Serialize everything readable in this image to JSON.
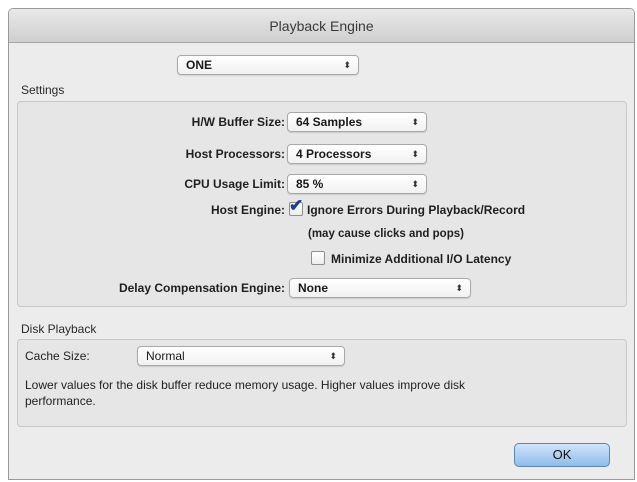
{
  "window": {
    "title": "Playback Engine"
  },
  "device": {
    "selected": "ONE",
    "arrows": "⬍"
  },
  "settings": {
    "heading": "Settings",
    "hw_buffer": {
      "label": "H/W Buffer Size:",
      "value": "64 Samples"
    },
    "host_processors": {
      "label": "Host Processors:",
      "value": "4 Processors"
    },
    "cpu_limit": {
      "label": "CPU Usage Limit:",
      "value": "85 %"
    },
    "host_engine": {
      "label": "Host Engine:",
      "ignore_errors_label": "Ignore Errors During Playback/Record",
      "ignore_errors_checked": true,
      "note": "(may cause clicks and pops)",
      "minimize_latency_label": "Minimize Additional I/O Latency",
      "minimize_latency_checked": false
    },
    "delay_comp": {
      "label": "Delay Compensation Engine:",
      "value": "None"
    }
  },
  "disk": {
    "heading": "Disk Playback",
    "cache_label": "Cache Size:",
    "cache_value": "Normal",
    "description": "Lower values for the disk buffer reduce memory usage.  Higher values improve disk performance."
  },
  "ok_label": "OK"
}
